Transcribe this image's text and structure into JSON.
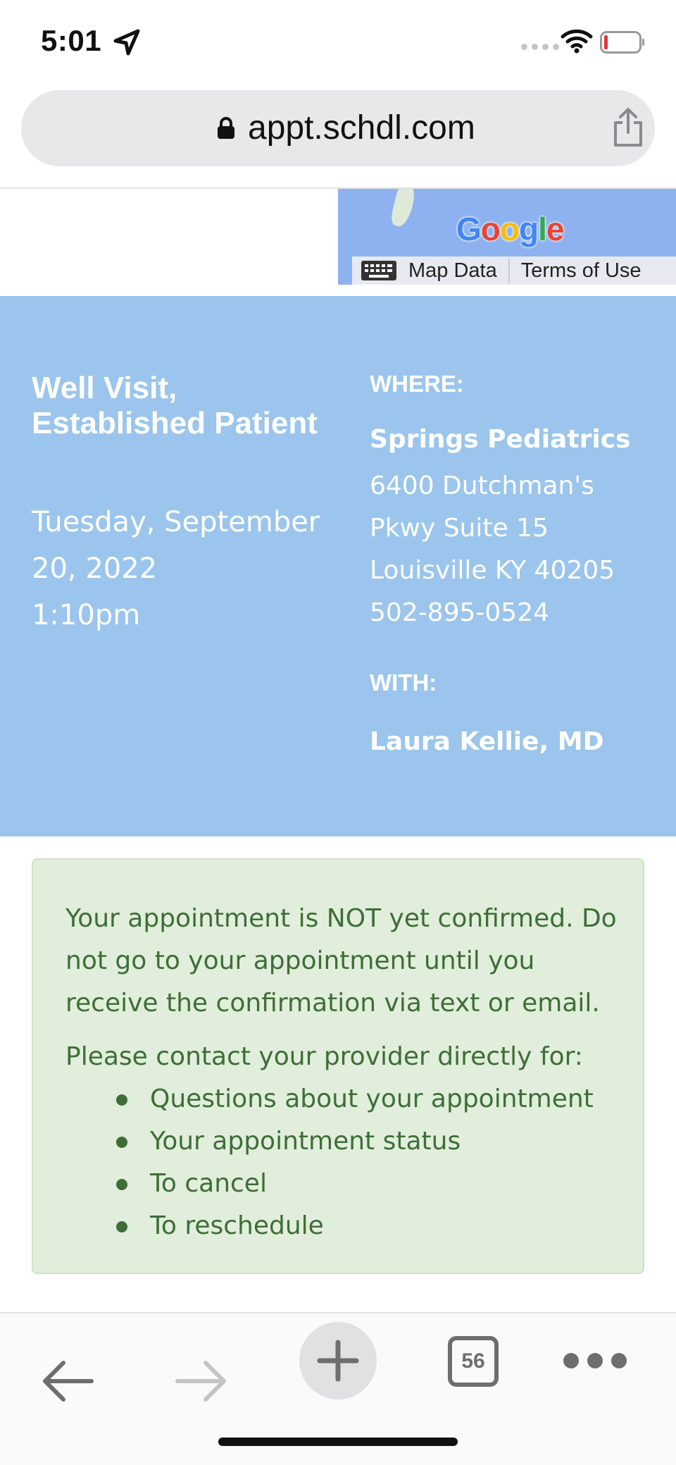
{
  "status_bar": {
    "time": "5:01",
    "icons": [
      "location-arrow-icon",
      "signal-dots-icon",
      "wifi-icon",
      "battery-low-icon"
    ]
  },
  "browser": {
    "url": "appt.schdl.com",
    "lock_icon": "lock-icon",
    "share_icon": "share-icon"
  },
  "map": {
    "logo_text": "Google",
    "logo_colors": [
      "#4285F4",
      "#EA4335",
      "#FBBC05",
      "#4285F4",
      "#34A853",
      "#EA4335"
    ],
    "map_data_label": "Map Data",
    "terms_label": "Terms of Use"
  },
  "appointment": {
    "title": "Well Visit, Established Patient",
    "date": "Tuesday, September 20, 2022",
    "time": "1:10pm",
    "where_label": "WHERE:",
    "clinic_name": "Springs Pediatrics",
    "address_line1": "6400 Dutchman's",
    "address_line2": "Pkwy Suite 15",
    "address_line3": "Louisville KY 40205",
    "phone": "502-895-0524",
    "with_label": "WITH:",
    "provider": "Laura Kellie, MD",
    "panel_color": "#9bc5ec"
  },
  "alert": {
    "message": "Your appointment is NOT yet confirmed. Do not go to your appointment until you receive the confirmation via text or email.",
    "contact_intro": "Please contact your provider directly for:",
    "items": [
      "Questions about your appointment",
      "Your appointment status",
      "To cancel",
      "To reschedule"
    ],
    "bg_color": "#e0eedb",
    "text_color": "#3f6d38"
  },
  "toolbar": {
    "tab_count": "56",
    "buttons": [
      "back-arrow-icon",
      "forward-arrow-icon",
      "plus-icon",
      "tabs-icon",
      "more-icon"
    ]
  }
}
